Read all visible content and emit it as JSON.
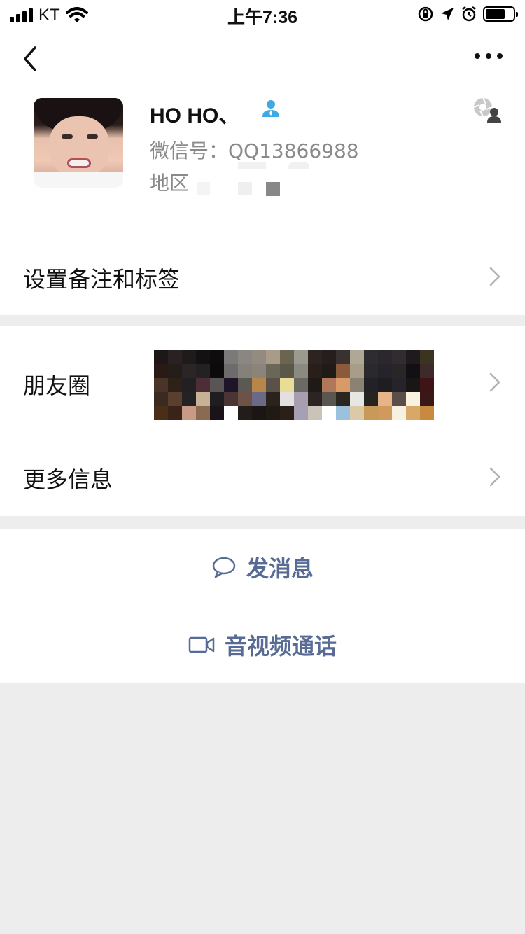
{
  "status_bar": {
    "carrier": "KT",
    "time": "上午7:36"
  },
  "profile": {
    "name": "HO HO、",
    "wechat_id": "微信号：QQ13866988",
    "region_label": "地区"
  },
  "rows": {
    "remark": "设置备注和标签",
    "moments": "朋友圈",
    "more_info": "更多信息"
  },
  "actions": {
    "message": "发消息",
    "call": "音视频通话"
  },
  "colors": {
    "link_blue": "#576b95",
    "background": "#ededed"
  }
}
